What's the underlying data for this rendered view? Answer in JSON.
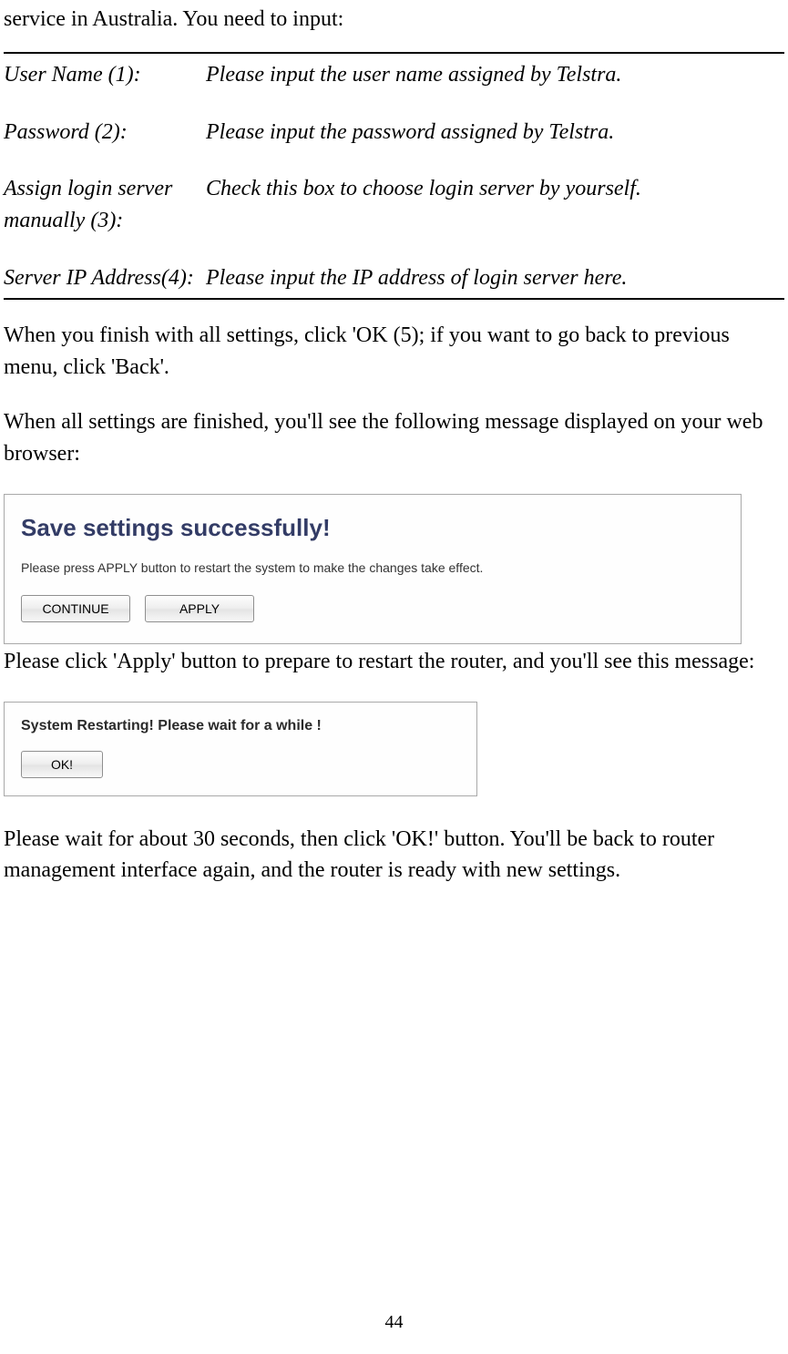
{
  "intro": "service in Australia. You need to input:",
  "rows": [
    {
      "label": "User Name (1):",
      "value": "Please input the user name assigned by Telstra."
    },
    {
      "label": "Password (2):",
      "value": "Please input the password assigned by Telstra."
    },
    {
      "label": "Assign login server manually (3):",
      "value": "Check this box to choose login server by yourself."
    },
    {
      "label": "Server IP Address(4):",
      "value": "Please input the IP address of login server here."
    }
  ],
  "p1": "When you finish with all settings, click 'OK (5); if you want to go back to previous menu, click 'Back'.",
  "p2": "When all settings are finished, you'll see the following message displayed on your web browser:",
  "panel1": {
    "title": "Save settings successfully!",
    "subtitle": "Please press APPLY button to restart the system to make the changes take effect.",
    "continue": "CONTINUE",
    "apply": "APPLY"
  },
  "p3": "Please click 'Apply' button to prepare to restart the router, and you'll see this message:",
  "panel2": {
    "title": "System Restarting! Please wait for a while !",
    "ok": "OK!"
  },
  "p4": "Please wait for about 30 seconds, then click 'OK!' button. You'll be back to router management interface again, and the router is ready with new settings.",
  "pagenum": "44"
}
